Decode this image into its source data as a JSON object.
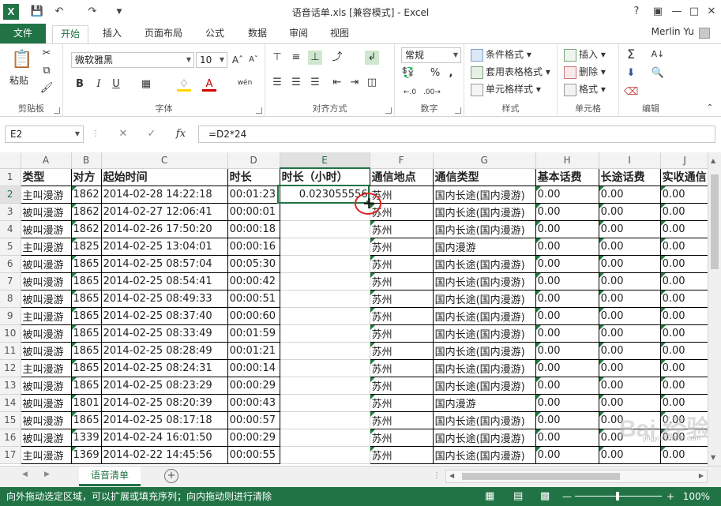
{
  "window": {
    "title": "语音话单.xls  [兼容模式] - Excel",
    "user": "Merlin Yu"
  },
  "tabs": {
    "file": "文件",
    "home": "开始",
    "insert": "插入",
    "layout": "页面布局",
    "formula": "公式",
    "data": "数据",
    "review": "审阅",
    "view": "视图"
  },
  "ribbon": {
    "clipboard": {
      "label": "剪贴板",
      "paste": "粘贴"
    },
    "font": {
      "label": "字体",
      "name": "微软雅黑",
      "size": "10",
      "bold": "B",
      "italic": "I",
      "underline": "U",
      "wen": "wén"
    },
    "alignment": {
      "label": "对齐方式"
    },
    "number": {
      "label": "数字",
      "format": "常规",
      "percent": "%",
      "comma": ","
    },
    "styles": {
      "label": "样式",
      "conditional": "条件格式",
      "table": "套用表格格式",
      "cell": "单元格样式"
    },
    "cells": {
      "label": "单元格",
      "insert": "插入",
      "delete": "删除",
      "format": "格式"
    },
    "editing": {
      "label": "编辑"
    }
  },
  "formula_bar": {
    "name_box": "E2",
    "formula": "=D2*24",
    "fx": "fx"
  },
  "columns": [
    "A",
    "B",
    "C",
    "D",
    "E",
    "F",
    "G",
    "H",
    "I",
    "J"
  ],
  "headers": [
    "类型",
    "对方",
    "起始时间",
    "时长",
    "时长（小时）",
    "通信地点",
    "通信类型",
    "基本话费",
    "长途话费",
    "实收通信"
  ],
  "rows": [
    {
      "n": "2",
      "a": "主叫漫游",
      "b": "1862",
      "c": "2014-02-28  14:22:18",
      "d": "00:01:23",
      "e": "0.023055556",
      "f": "苏州",
      "g": "国内长途(国内漫游)",
      "h": "0.00",
      "i": "0.00",
      "j": "0.00"
    },
    {
      "n": "3",
      "a": "被叫漫游",
      "b": "1862",
      "c": "2014-02-27  12:06:41",
      "d": "00:00:01",
      "e": "",
      "f": "苏州",
      "g": "国内长途(国内漫游)",
      "h": "0.00",
      "i": "0.00",
      "j": "0.00"
    },
    {
      "n": "4",
      "a": "被叫漫游",
      "b": "1862",
      "c": "2014-02-26  17:50:20",
      "d": "00:00:18",
      "e": "",
      "f": "苏州",
      "g": "国内长途(国内漫游)",
      "h": "0.00",
      "i": "0.00",
      "j": "0.00"
    },
    {
      "n": "5",
      "a": "主叫漫游",
      "b": "1825",
      "c": "2014-02-25  13:04:01",
      "d": "00:00:16",
      "e": "",
      "f": "苏州",
      "g": "国内漫游",
      "h": "0.00",
      "i": "0.00",
      "j": "0.00"
    },
    {
      "n": "6",
      "a": "被叫漫游",
      "b": "1865",
      "c": "2014-02-25  08:57:04",
      "d": "00:05:30",
      "e": "",
      "f": "苏州",
      "g": "国内长途(国内漫游)",
      "h": "0.00",
      "i": "0.00",
      "j": "0.00"
    },
    {
      "n": "7",
      "a": "被叫漫游",
      "b": "1865",
      "c": "2014-02-25  08:54:41",
      "d": "00:00:42",
      "e": "",
      "f": "苏州",
      "g": "国内长途(国内漫游)",
      "h": "0.00",
      "i": "0.00",
      "j": "0.00"
    },
    {
      "n": "8",
      "a": "被叫漫游",
      "b": "1865",
      "c": "2014-02-25  08:49:33",
      "d": "00:00:51",
      "e": "",
      "f": "苏州",
      "g": "国内长途(国内漫游)",
      "h": "0.00",
      "i": "0.00",
      "j": "0.00"
    },
    {
      "n": "9",
      "a": "主叫漫游",
      "b": "1865",
      "c": "2014-02-25  08:37:40",
      "d": "00:00:60",
      "e": "",
      "f": "苏州",
      "g": "国内长途(国内漫游)",
      "h": "0.00",
      "i": "0.00",
      "j": "0.00"
    },
    {
      "n": "10",
      "a": "被叫漫游",
      "b": "1865",
      "c": "2014-02-25  08:33:49",
      "d": "00:01:59",
      "e": "",
      "f": "苏州",
      "g": "国内长途(国内漫游)",
      "h": "0.00",
      "i": "0.00",
      "j": "0.00"
    },
    {
      "n": "11",
      "a": "被叫漫游",
      "b": "1865",
      "c": "2014-02-25  08:28:49",
      "d": "00:01:21",
      "e": "",
      "f": "苏州",
      "g": "国内长途(国内漫游)",
      "h": "0.00",
      "i": "0.00",
      "j": "0.00"
    },
    {
      "n": "12",
      "a": "主叫漫游",
      "b": "1865",
      "c": "2014-02-25  08:24:31",
      "d": "00:00:14",
      "e": "",
      "f": "苏州",
      "g": "国内长途(国内漫游)",
      "h": "0.00",
      "i": "0.00",
      "j": "0.00"
    },
    {
      "n": "13",
      "a": "被叫漫游",
      "b": "1865",
      "c": "2014-02-25  08:23:29",
      "d": "00:00:29",
      "e": "",
      "f": "苏州",
      "g": "国内长途(国内漫游)",
      "h": "0.00",
      "i": "0.00",
      "j": "0.00"
    },
    {
      "n": "14",
      "a": "被叫漫游",
      "b": "1801",
      "c": "2014-02-25  08:20:39",
      "d": "00:00:43",
      "e": "",
      "f": "苏州",
      "g": "国内漫游",
      "h": "0.00",
      "i": "0.00",
      "j": "0.00"
    },
    {
      "n": "15",
      "a": "被叫漫游",
      "b": "1865",
      "c": "2014-02-25  08:17:18",
      "d": "00:00:57",
      "e": "",
      "f": "苏州",
      "g": "国内长途(国内漫游)",
      "h": "0.00",
      "i": "0.00",
      "j": "0.00"
    },
    {
      "n": "16",
      "a": "被叫漫游",
      "b": "1339",
      "c": "2014-02-24  16:01:50",
      "d": "00:00:29",
      "e": "",
      "f": "苏州",
      "g": "国内长途(国内漫游)",
      "h": "0.00",
      "i": "0.00",
      "j": "0.00"
    },
    {
      "n": "17",
      "a": "主叫漫游",
      "b": "1369",
      "c": "2014-02-22  14:45:56",
      "d": "00:00:55",
      "e": "",
      "f": "苏州",
      "g": "国内长途(国内漫游)",
      "h": "0.00",
      "i": "0.00",
      "j": "0.00"
    }
  ],
  "sheet_tab": "语音清单",
  "status": {
    "message": "向外拖动选定区域，可以扩展或填充序列；向内拖动则进行清除",
    "zoom": "100%"
  },
  "watermark": {
    "brand": "Bai 经验",
    "url": "jingyan.baidu.com"
  }
}
